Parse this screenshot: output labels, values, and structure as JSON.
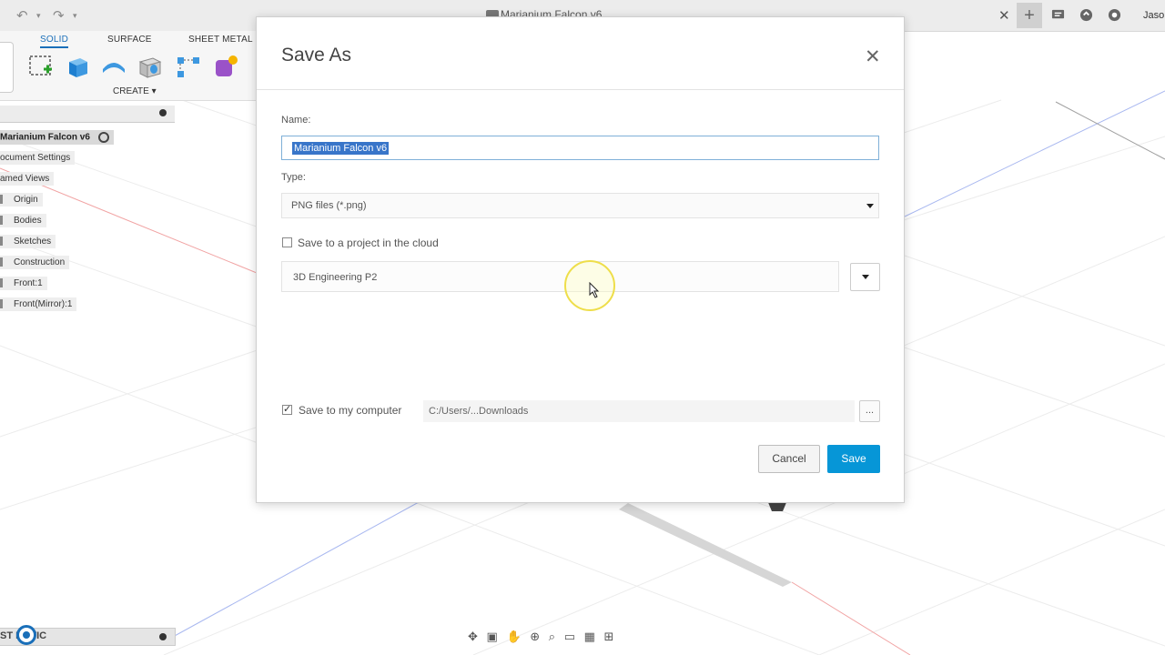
{
  "titlebar": {
    "tab_title": "Marianium Falcon v6",
    "user": "Jaso"
  },
  "ribbon": {
    "tabs": [
      "SOLID",
      "SURFACE",
      "SHEET METAL"
    ],
    "active_tab": "SOLID",
    "create_label": "CREATE ▾"
  },
  "browser": {
    "root": "Marianium Falcon v6",
    "items": [
      "ocument Settings",
      "amed Views",
      "Origin",
      "Bodies",
      "Sketches",
      "Construction",
      "Front:1",
      "Front(Mirror):1"
    ]
  },
  "bottom_left": {
    "label": "ST  MATIC"
  },
  "dialog": {
    "title": "Save As",
    "name_label": "Name:",
    "name_value": "Marianium Falcon v6",
    "type_label": "Type:",
    "type_value": "PNG files (*.png)",
    "cloud_checkbox_label": "Save to a project in the cloud",
    "cloud_checked": false,
    "project_value": "3D Engineering P2",
    "computer_checkbox_label": "Save to my computer",
    "computer_checked": true,
    "path_value": "C:/Users/...Downloads",
    "browse_label": "...",
    "cancel_label": "Cancel",
    "save_label": "Save"
  },
  "colors": {
    "accent": "#0696d7",
    "selection": "#3875c9",
    "ribbon_active": "#1a6fb9"
  }
}
